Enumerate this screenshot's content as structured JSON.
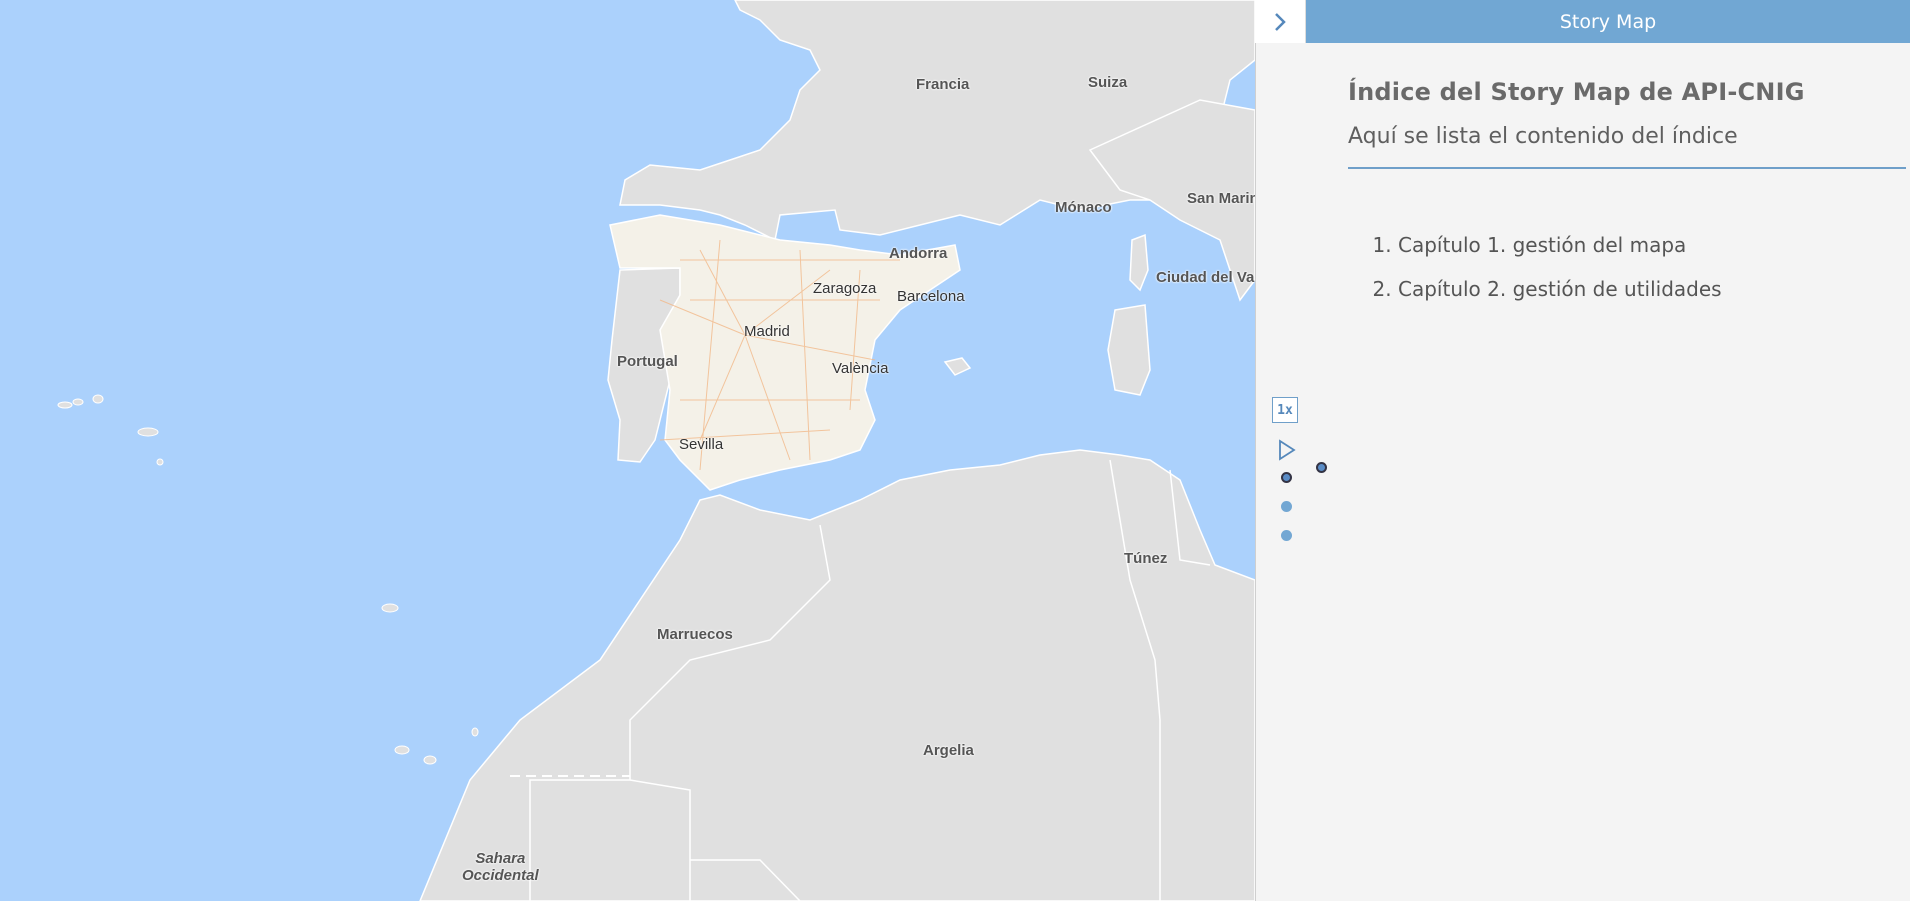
{
  "panel": {
    "title_bar": "Story Map",
    "heading": "Índice del Story Map de API-CNIG",
    "subheading": "Aquí se lista el contenido del índice",
    "chapters": [
      "Capítulo 1. gestión del mapa",
      "Capítulo 2. gestión de utilidades"
    ],
    "speed_label": "1x",
    "accent_color": "#71a7d3"
  },
  "map": {
    "labels": {
      "francia": "Francia",
      "suiza": "Suiza",
      "monaco": "Mónaco",
      "san_marino": "San Marin",
      "andorra": "Andorra",
      "ciudad_vaticano": "Ciudad del Va",
      "zaragoza": "Zaragoza",
      "barcelona": "Barcelona",
      "madrid": "Madrid",
      "portugal": "Portugal",
      "valencia": "València",
      "sevilla": "Sevilla",
      "tunez": "Túnez",
      "marruecos": "Marruecos",
      "argelia": "Argelia",
      "sahara_1": "Sahara",
      "sahara_2": "Occidental"
    },
    "sea_color": "#abd1fc",
    "land_color": "#e0e0e0"
  }
}
